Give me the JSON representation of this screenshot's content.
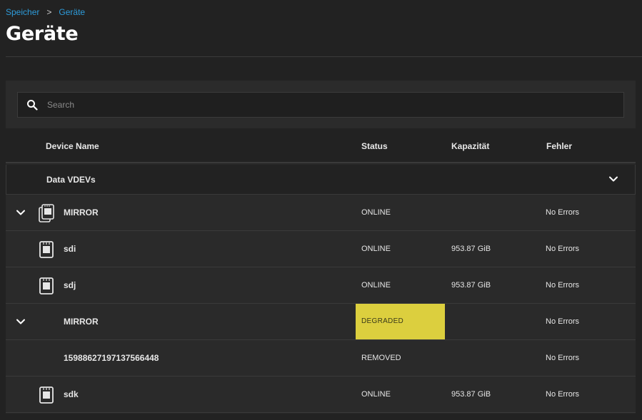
{
  "breadcrumb": {
    "items": [
      "Speicher",
      "Geräte"
    ],
    "separator": ">"
  },
  "page": {
    "title": "Geräte"
  },
  "search": {
    "placeholder": "Search",
    "value": ""
  },
  "table": {
    "columns": {
      "device_name": "Device Name",
      "status": "Status",
      "capacity": "Kapazität",
      "errors": "Fehler"
    },
    "group": {
      "label": "Data VDEVs",
      "expanded": true
    },
    "rows": [
      {
        "name": "MIRROR",
        "status": "ONLINE",
        "capacity": "",
        "errors": "No Errors",
        "icon": "mirror-icon",
        "expandable": true
      },
      {
        "name": "sdi",
        "status": "ONLINE",
        "capacity": "953.87 GiB",
        "errors": "No Errors",
        "icon": "disk-icon",
        "expandable": false
      },
      {
        "name": "sdj",
        "status": "ONLINE",
        "capacity": "953.87 GiB",
        "errors": "No Errors",
        "icon": "disk-icon",
        "expandable": false
      },
      {
        "name": "MIRROR",
        "status": "DEGRADED",
        "capacity": "",
        "errors": "No Errors",
        "icon": "",
        "expandable": true
      },
      {
        "name": "15988627197137566448",
        "status": "REMOVED",
        "capacity": "",
        "errors": "No Errors",
        "icon": "",
        "expandable": false
      },
      {
        "name": "sdk",
        "status": "ONLINE",
        "capacity": "953.87 GiB",
        "errors": "No Errors",
        "icon": "disk-icon",
        "expandable": false
      }
    ]
  },
  "colors": {
    "accent_link": "#2d9cdb",
    "degraded": "#dccf3e",
    "background": "#222222"
  }
}
